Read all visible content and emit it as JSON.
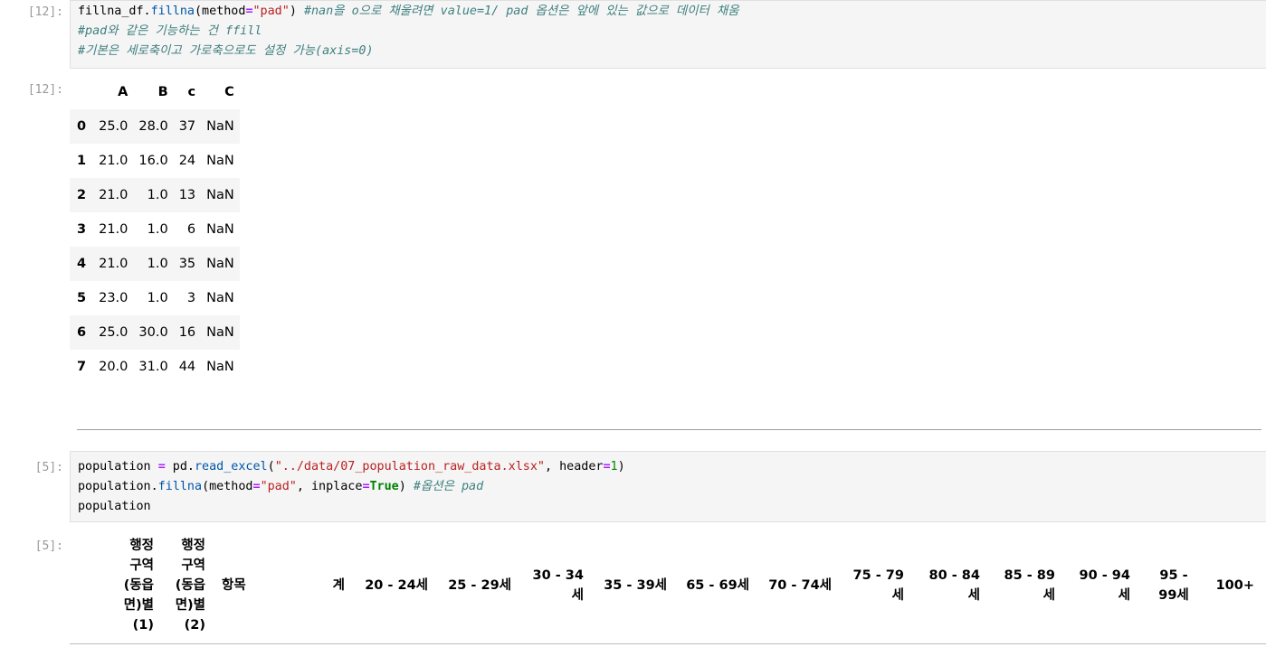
{
  "cells": [
    {
      "prompt_in": "[12]:",
      "code_lines": [
        [
          [
            "",
            "fillna_df."
          ],
          [
            "fn",
            "fillna"
          ],
          [
            "",
            "(method"
          ],
          [
            "op",
            "="
          ],
          [
            "str",
            "\"pad\""
          ],
          [
            "",
            ") "
          ],
          [
            "cm",
            "#nan을 o으로 채울려면 value=1/ pad 옵션은 앞에 있는 값으로 데이터 채움"
          ]
        ],
        [
          [
            "cm",
            "#pad와 같은 기능하는 건 ffill"
          ]
        ],
        [
          [
            "cm",
            "#기본은 세로축이고 가로축으로도 설정 가능(axis=0)"
          ]
        ]
      ],
      "prompt_out": "[12]:"
    },
    {
      "prompt_in": "[5]:",
      "code_lines": [
        [
          [
            "",
            "population "
          ],
          [
            "op",
            "="
          ],
          [
            "",
            " pd."
          ],
          [
            "fn",
            "read_excel"
          ],
          [
            "",
            "("
          ],
          [
            "str",
            "\"../data/07_population_raw_data.xlsx\""
          ],
          [
            "",
            ", header"
          ],
          [
            "op",
            "="
          ],
          [
            "num",
            "1"
          ],
          [
            "",
            ")"
          ]
        ],
        [
          [
            "",
            "population."
          ],
          [
            "fn",
            "fillna"
          ],
          [
            "",
            "(method"
          ],
          [
            "op",
            "="
          ],
          [
            "str",
            "\"pad\""
          ],
          [
            "",
            ", inplace"
          ],
          [
            "op",
            "="
          ],
          [
            "kw",
            "True"
          ],
          [
            "",
            ") "
          ],
          [
            "cm",
            "#옵션은 pad"
          ]
        ],
        [
          [
            "",
            "population"
          ]
        ]
      ],
      "prompt_out": "[5]:"
    }
  ],
  "fillna_table": {
    "columns": [
      "A",
      "B",
      "c",
      "C"
    ],
    "rows": [
      {
        "index": "0",
        "values": [
          "25.0",
          "28.0",
          "37",
          "NaN"
        ]
      },
      {
        "index": "1",
        "values": [
          "21.0",
          "16.0",
          "24",
          "NaN"
        ]
      },
      {
        "index": "2",
        "values": [
          "21.0",
          "1.0",
          "13",
          "NaN"
        ]
      },
      {
        "index": "3",
        "values": [
          "21.0",
          "1.0",
          "6",
          "NaN"
        ]
      },
      {
        "index": "4",
        "values": [
          "21.0",
          "1.0",
          "35",
          "NaN"
        ]
      },
      {
        "index": "5",
        "values": [
          "23.0",
          "1.0",
          "3",
          "NaN"
        ]
      },
      {
        "index": "6",
        "values": [
          "25.0",
          "30.0",
          "16",
          "NaN"
        ]
      },
      {
        "index": "7",
        "values": [
          "20.0",
          "31.0",
          "44",
          "NaN"
        ]
      }
    ]
  },
  "population_headers": [
    "행정\n구역\n(동읍\n면)별\n(1)",
    "행정\n구역\n(동읍\n면)별\n(2)",
    "항목",
    "계",
    "20 - 24세",
    "25 - 29세",
    "30 - 34\n세",
    "35 - 39세",
    "65 - 69세",
    "70 - 74세",
    "75 - 79\n세",
    "80 - 84\n세",
    "85 - 89\n세",
    "90 - 94\n세",
    "95 -\n99세",
    "100+"
  ]
}
